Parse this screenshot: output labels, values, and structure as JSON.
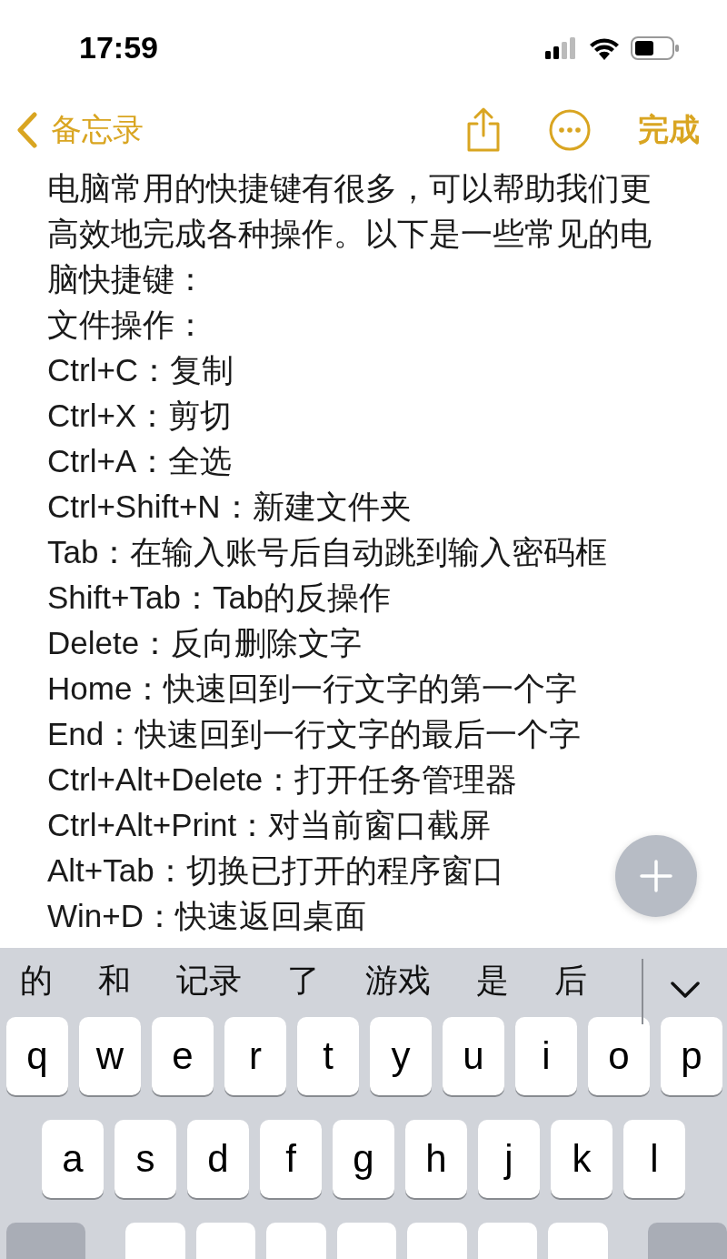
{
  "status_bar": {
    "time": "17:59"
  },
  "nav": {
    "back_label": "备忘录",
    "done_label": "完成"
  },
  "note": {
    "lines": [
      "电脑常用的快捷键有很多，可以帮助我们更高效地完成各种操作。以下是一些常见的电脑快捷键：",
      "文件操作：",
      "Ctrl+C：复制",
      "Ctrl+X：剪切",
      "Ctrl+A：全选",
      "Ctrl+Shift+N：新建文件夹",
      "Tab：在输入账号后自动跳到输入密码框",
      "Shift+Tab：Tab的反操作",
      "Delete：反向删除文字",
      "Home：快速回到一行文字的第一个字",
      "End：快速回到一行文字的最后一个字",
      "Ctrl+Alt+Delete：打开任务管理器",
      "Ctrl+Alt+Print：对当前窗口截屏",
      "Alt+Tab：切换已打开的程序窗口",
      "Win+D：快速返回桌面"
    ]
  },
  "keyboard": {
    "candidates": [
      "的",
      "和",
      "记录",
      "了",
      "游戏",
      "是",
      "后"
    ],
    "rows": [
      [
        "q",
        "w",
        "e",
        "r",
        "t",
        "y",
        "u",
        "i",
        "o",
        "p"
      ],
      [
        "a",
        "s",
        "d",
        "f",
        "g",
        "h",
        "j",
        "k",
        "l"
      ]
    ]
  }
}
